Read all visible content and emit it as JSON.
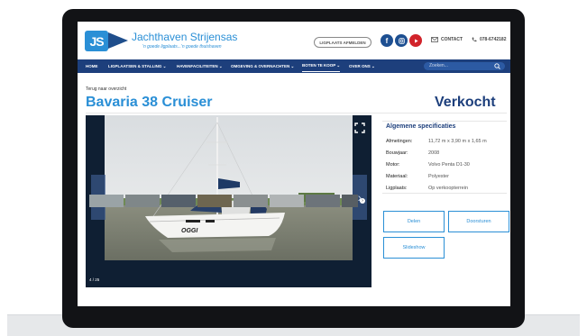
{
  "header": {
    "logo_text": "JS",
    "brand_name": "Jachthaven Strijensas",
    "tagline": "'n goede ligplaats...'n goede thuishaven",
    "login_button": "LIGPLAATS AFMELDEN",
    "social_icons": [
      "facebook-icon",
      "instagram-icon",
      "youtube-icon"
    ],
    "contact_label": "CONTACT",
    "phone": "078-6742182"
  },
  "nav": {
    "items": [
      {
        "label": "HOME"
      },
      {
        "label": "LIGPLAATSEN & STALLING ⌄"
      },
      {
        "label": "HAVENFACILITEITEN ⌄"
      },
      {
        "label": "OMGEVING & OVERNACHTEN ⌄"
      },
      {
        "label": "BOTEN TE KOOP ⌄",
        "active": true
      },
      {
        "label": "OVER ONS ⌄"
      }
    ],
    "search_placeholder": "Zoeken..."
  },
  "page": {
    "back_link": "Terug naar overzicht",
    "title": "Bavaria 38 Cruiser",
    "status": "Verkocht"
  },
  "gallery": {
    "counter": "4 / 25",
    "boat_name": "OGGI",
    "thumbnail_count": 8
  },
  "specs": {
    "title": "Algemene specificaties",
    "rows": [
      {
        "label": "Afmetingen:",
        "value": "11,72 m x 3,90 m x 1,65 m"
      },
      {
        "label": "Bouwjaar:",
        "value": "2008"
      },
      {
        "label": "Motor:",
        "value": "Volvo Penta D1-30"
      },
      {
        "label": "Materiaal:",
        "value": "Polyester"
      },
      {
        "label": "Ligplaats:",
        "value": "Op verkoopterrein"
      }
    ]
  },
  "actions": {
    "share": "Delen",
    "forward": "Doorsturen",
    "slideshow": "Slideshow"
  },
  "colors": {
    "primary_blue": "#2a8fd6",
    "navy": "#1d3f7c",
    "youtube_red": "#d1232a"
  }
}
